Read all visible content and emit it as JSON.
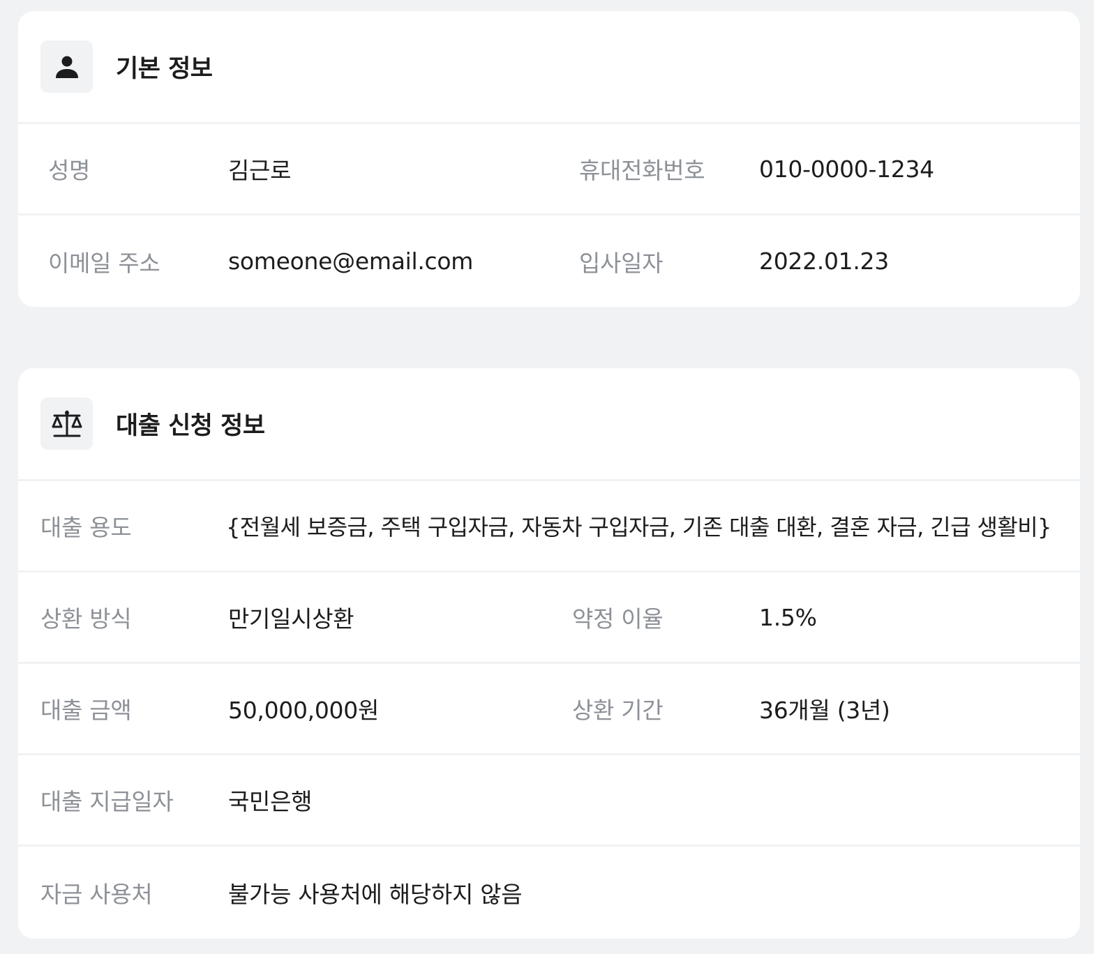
{
  "basic_info": {
    "title": "기본 정보",
    "icon": "person-icon",
    "rows": [
      {
        "label1": "성명",
        "value1": "김근로",
        "label2": "휴대전화번호",
        "value2": "010-0000-1234"
      },
      {
        "label1": "이메일 주소",
        "value1": "someone@email.com",
        "label2": "입사일자",
        "value2": "2022.01.23"
      }
    ]
  },
  "loan_info": {
    "title": "대출 신청 정보",
    "icon": "scale-icon",
    "purpose": {
      "label": "대출 용도",
      "value": "{전월세 보증금, 주택 구입자금, 자동차 구입자금, 기존 대출 대환, 결혼 자금, 긴급 생활비}"
    },
    "rows": [
      {
        "label1": "상환 방식",
        "value1": "만기일시상환",
        "label2": "약정 이율",
        "value2": "1.5%"
      },
      {
        "label1": "대출 금액",
        "value1": "50,000,000원",
        "label2": "상환 기간",
        "value2": "36개월 (3년)"
      }
    ],
    "disbursement": {
      "label": "대출 지급일자",
      "value": "국민은행"
    },
    "fund_usage": {
      "label": "자금 사용처",
      "value": "불가능 사용처에 해당하지 않음"
    }
  },
  "colors": {
    "background": "#f1f2f4",
    "card": "#ffffff",
    "label": "#8d9197",
    "value": "#1c1c1e"
  }
}
